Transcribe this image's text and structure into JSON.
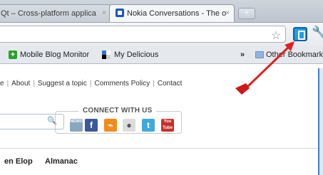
{
  "browser": {
    "tabs": [
      {
        "title": "Qt – Cross-platform applica",
        "close": "×",
        "active": false
      },
      {
        "title": "Nokia Conversations - The o",
        "close": "×",
        "active": true
      }
    ],
    "new_tab": "+"
  },
  "toolbar": {
    "star": "☆",
    "wrench": "🔧"
  },
  "bookmarks": [
    {
      "label": "Mobile Blog Monitor"
    },
    {
      "label": "My Delicious"
    },
    {
      "label": "»"
    },
    {
      "label": "Other Bookmarks"
    }
  ],
  "page": {
    "nav_links": [
      "e",
      "About",
      "Suggest a topic",
      "Comments Policy",
      "Contact"
    ],
    "connect_title": "CONNECT WITH US",
    "search_icon": "🔍",
    "social": [
      {
        "name": "news",
        "glyph": "NEWS"
      },
      {
        "name": "facebook",
        "glyph": "f"
      },
      {
        "name": "rss",
        "glyph": "⌁"
      },
      {
        "name": "podcast",
        "glyph": "●"
      },
      {
        "name": "twitter",
        "glyph": "t"
      },
      {
        "name": "youtube",
        "glyph": "You Tube"
      }
    ],
    "menu": [
      "en Elop",
      "Almanac"
    ]
  },
  "colors": {
    "annotation_arrow": "#e02020",
    "accent": "#3b7fd9"
  }
}
